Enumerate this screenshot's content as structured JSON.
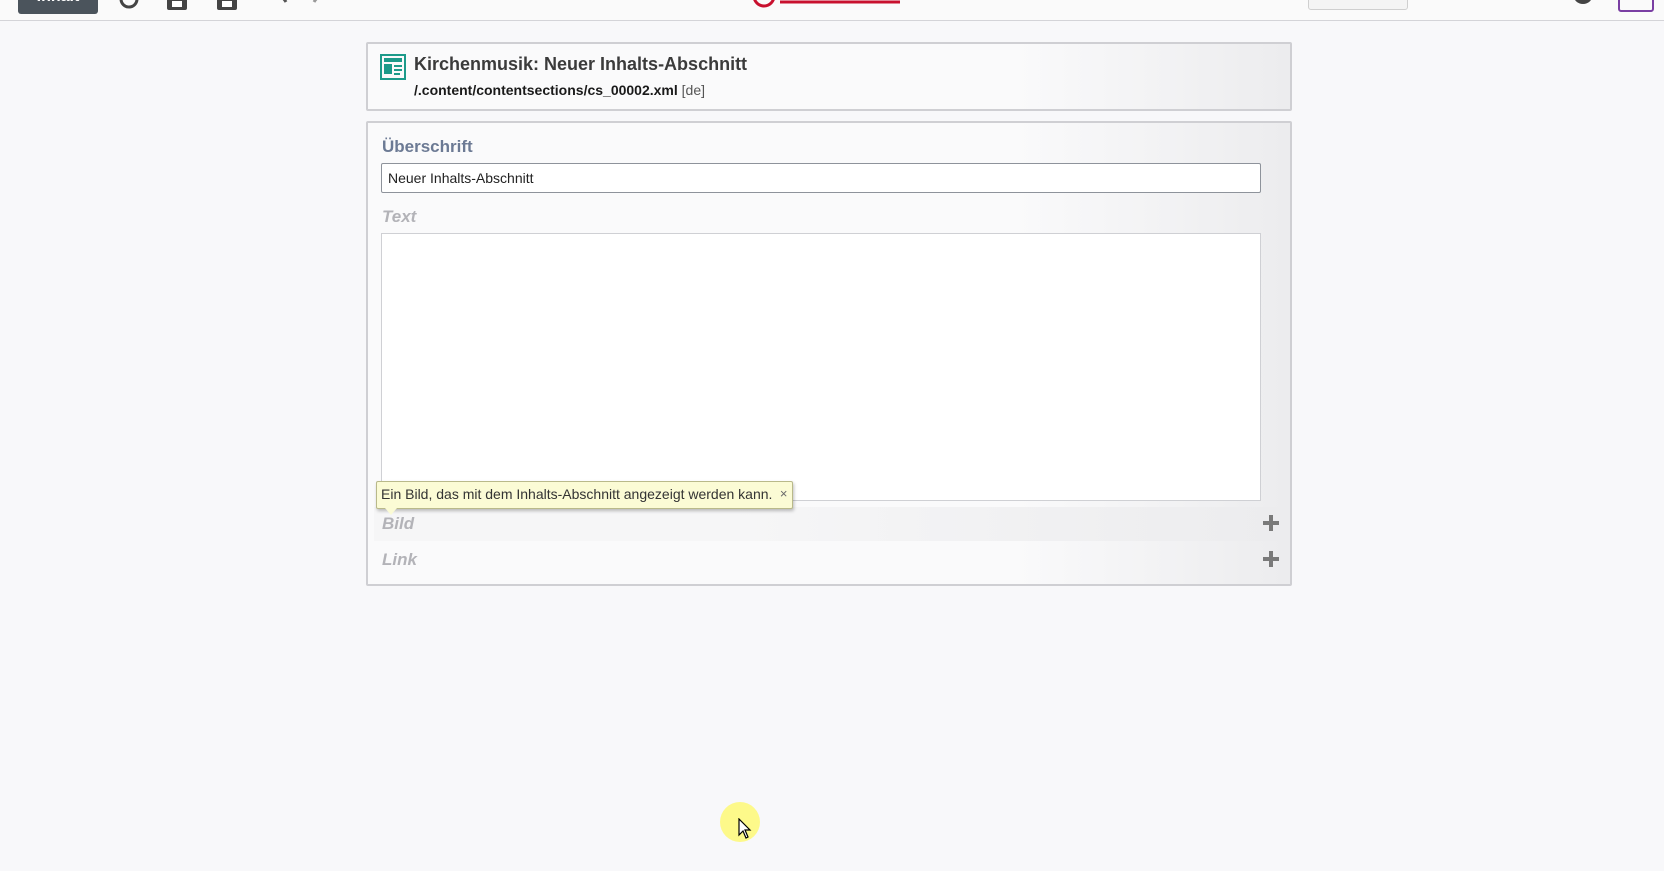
{
  "toolbar": {
    "main_button_label": "Inhalt",
    "icons": [
      "refresh-icon",
      "save-exit-icon",
      "save-icon",
      "undo-icon",
      "redo-icon"
    ],
    "right_icons": [
      "bell-icon",
      "chat-icon",
      "publish-icon",
      "user-icon",
      "apps-icon"
    ],
    "logo": "opencms"
  },
  "header": {
    "title": "Kirchenmusik: Neuer Inhalts-Abschnitt",
    "path": "/.content/contentsections/cs_00002.xml",
    "locale": "[de]"
  },
  "form": {
    "heading_label": "Überschrift",
    "heading_value": "Neuer Inhalts-Abschnitt",
    "text_label": "Text",
    "text_value": "",
    "image_label": "Bild",
    "link_label": "Link",
    "tooltip_text": "Ein Bild, das mit dem Inhalts-Abschnitt angezeigt werden kann.",
    "tooltip_close": "×"
  },
  "colors": {
    "label_active": "#6c7a94",
    "label_optional": "#b3b3b8",
    "tooltip_bg": "#fbfbd5",
    "toolbar_button": "#4b545c",
    "resource_icon": "#1c9a8a"
  }
}
